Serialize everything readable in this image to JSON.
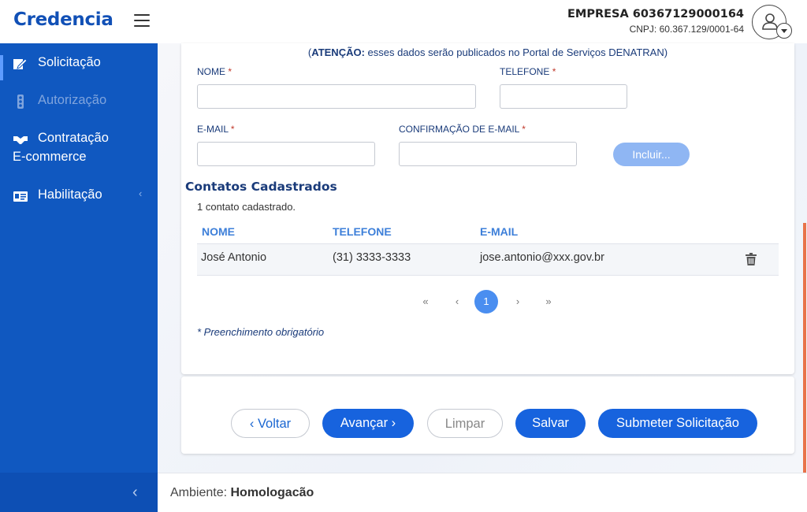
{
  "header": {
    "logo": "Credencia",
    "company_name": "EMPRESA 60367129000164",
    "company_cnpj": "CNPJ: 60.367.129/0001-64"
  },
  "sidebar": {
    "items": [
      {
        "label": "Solicitação",
        "icon": "edit-document-icon",
        "state": "active"
      },
      {
        "label": "Autorização",
        "icon": "traffic-light-icon",
        "state": "disabled"
      },
      {
        "label": "Contratação",
        "label2": "E-commerce",
        "icon": "handshake-icon",
        "state": "normal"
      },
      {
        "label": "Habilitação",
        "icon": "id-card-icon",
        "state": "normal",
        "chevron": "‹"
      }
    ],
    "collapse_icon": "‹"
  },
  "form": {
    "notice_prefix": "(",
    "notice_bold": "ATENÇÃO:",
    "notice_rest": " esses dados serão publicados no Portal de Serviços DENATRAN)",
    "nome_label": "NOME",
    "telefone_label": "TELEFONE",
    "email_label": "E-MAIL",
    "confirm_email_label": "CONFIRMAÇÃO DE E-MAIL",
    "required_mark": "*",
    "nome_value": "",
    "telefone_value": "",
    "email_value": "",
    "confirm_email_value": "",
    "incluir_label": "Incluir..."
  },
  "contacts": {
    "title": "Contatos Cadastrados",
    "count_text": "1 contato cadastrado.",
    "columns": [
      "NOME",
      "TELEFONE",
      "E-MAIL"
    ],
    "rows": [
      {
        "nome": "José Antonio",
        "telefone": "(31) 3333-3333",
        "email": "jose.antonio@xxx.gov.br"
      }
    ]
  },
  "pagination": {
    "first": "«",
    "prev": "‹",
    "current": "1",
    "next": "›",
    "last": "»"
  },
  "required_note": "* Preenchimento obrigatório",
  "actions": {
    "voltar": "Voltar",
    "avancar": "Avançar",
    "limpar": "Limpar",
    "salvar": "Salvar",
    "submeter": "Submeter Solicitação"
  },
  "footer": {
    "label": "Ambiente: ",
    "value": "Homologacão"
  },
  "colors": {
    "sidebar": "#1058c0",
    "primary": "#1763de",
    "accent": "#e8734a"
  }
}
